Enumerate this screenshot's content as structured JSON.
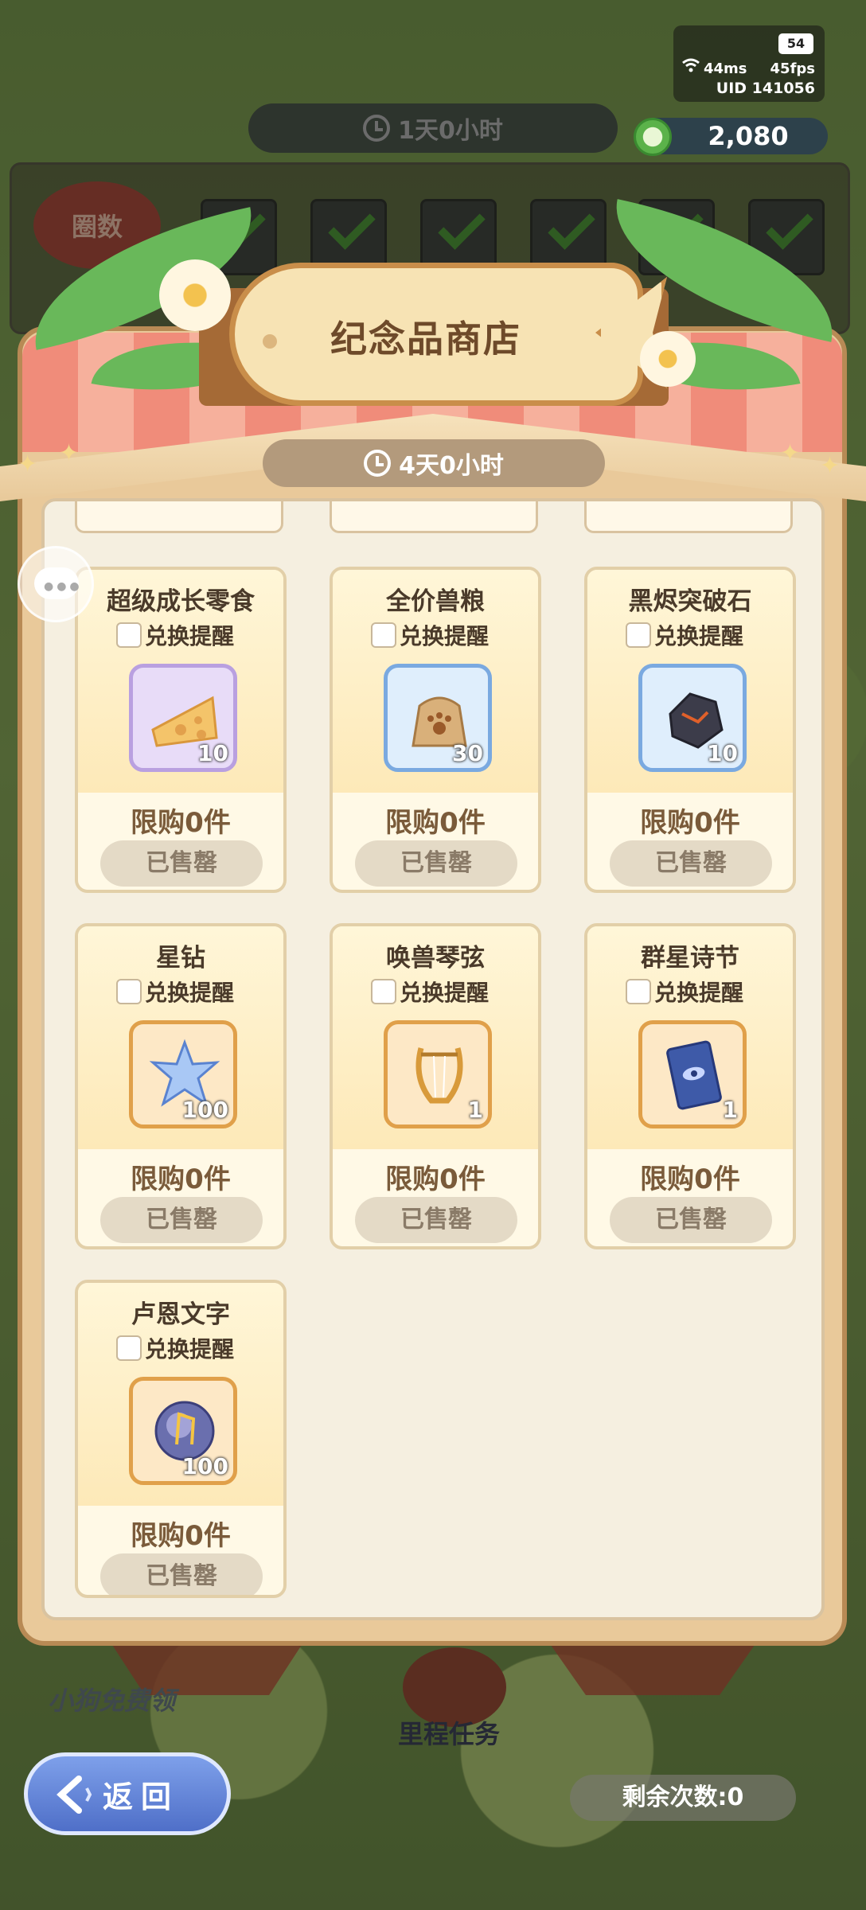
{
  "status": {
    "battery": "54",
    "ping": "44ms",
    "fps": "45fps",
    "uid": "UID 141056"
  },
  "event_timer": "1天0小时",
  "currency": {
    "amount": "2,080",
    "icon": "green-coin-icon"
  },
  "milestone": {
    "laps_label": "圈数"
  },
  "shop": {
    "title": "纪念品商店",
    "timer": "4天0小时",
    "items": [
      {
        "name": "超级成长零食",
        "remind": "兑换提醒",
        "qty": "10",
        "limit": "限购0件",
        "button": "已售罄",
        "icon": "cheese-icon",
        "frame": "purple"
      },
      {
        "name": "全价兽粮",
        "remind": "兑换提醒",
        "qty": "30",
        "limit": "限购0件",
        "button": "已售罄",
        "icon": "food-sack-icon",
        "frame": "blue"
      },
      {
        "name": "黑烬突破石",
        "remind": "兑换提醒",
        "qty": "10",
        "limit": "限购0件",
        "button": "已售罄",
        "icon": "black-stone-icon",
        "frame": "blue"
      },
      {
        "name": "星钻",
        "remind": "兑换提醒",
        "qty": "100",
        "limit": "限购0件",
        "button": "已售罄",
        "icon": "star-diamond-icon",
        "frame": "gold"
      },
      {
        "name": "唤兽琴弦",
        "remind": "兑换提醒",
        "qty": "1",
        "limit": "限购0件",
        "button": "已售罄",
        "icon": "lyre-icon",
        "frame": "gold"
      },
      {
        "name": "群星诗节",
        "remind": "兑换提醒",
        "qty": "1",
        "limit": "限购0件",
        "button": "已售罄",
        "icon": "card-icon",
        "frame": "gold"
      },
      {
        "name": "卢恩文字",
        "remind": "兑换提醒",
        "qty": "100",
        "limit": "限购0件",
        "button": "已售罄",
        "icon": "rune-orb-icon",
        "frame": "gold"
      }
    ]
  },
  "bottom": {
    "free_label": "小狗免费领",
    "milestone_task": "里程任务",
    "remaining": "剩余次数:0",
    "back": "返回"
  }
}
